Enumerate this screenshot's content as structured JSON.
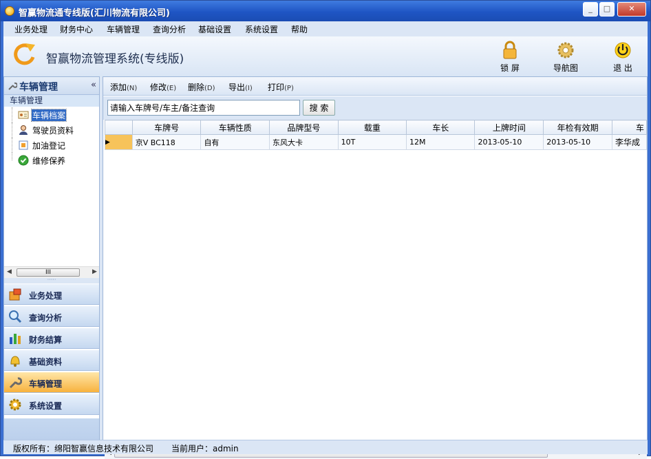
{
  "window": {
    "title": "智赢物流通专线版(汇川物流有限公司)"
  },
  "menu": [
    "业务处理",
    "财务中心",
    "车辆管理",
    "查询分析",
    "基础设置",
    "系统设置",
    "帮助"
  ],
  "header": {
    "app_title": "智赢物流管理系统(专线版)",
    "buttons": {
      "lock": "锁 屏",
      "nav": "导航图",
      "exit": "退 出"
    }
  },
  "sidebar": {
    "title": "车辆管理",
    "collapse": "«",
    "group": "车辆管理",
    "items": [
      "车辆档案",
      "驾驶员资料",
      "加油登记",
      "维修保养"
    ],
    "selected": "车辆档案",
    "nav": [
      "业务处理",
      "查询分析",
      "财务结算",
      "基础资料",
      "车辆管理",
      "系统设置"
    ],
    "active_nav": "车辆管理"
  },
  "toolbar": {
    "add": "添加",
    "add_key": "(N)",
    "edit": "修改",
    "edit_key": "(E)",
    "delete": "删除",
    "delete_key": "(D)",
    "export": "导出",
    "export_key": "(I)",
    "print": "打印",
    "print_key": "(P)"
  },
  "search": {
    "value": "请输入车牌号/车主/备注查询",
    "button": "搜 索"
  },
  "table": {
    "columns": [
      "车牌号",
      "车辆性质",
      "品牌型号",
      "载重",
      "车长",
      "上牌时间",
      "年检有效期",
      "车"
    ],
    "rows": [
      [
        "京V BC118",
        "自有",
        "东风大卡",
        "10T",
        "12M",
        "2013-05-10",
        "2013-05-10",
        "李华成"
      ]
    ]
  },
  "status": {
    "copyright": "版权所有：绵阳智赢信息技术有限公司",
    "user": "当前用户：admin"
  },
  "colors": {
    "title_bar": "#1f55c4",
    "chrome": "#dbe6f5",
    "selection": "#316ac5",
    "active_nav": "#f7b23e"
  }
}
